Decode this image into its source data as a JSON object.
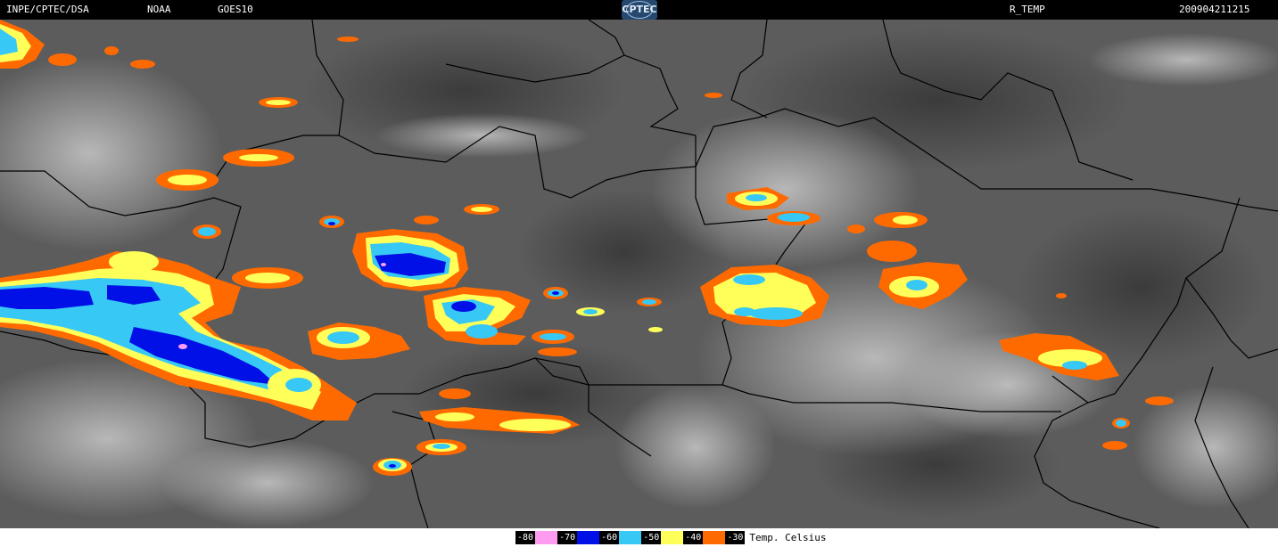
{
  "header": {
    "source": "INPE/CPTEC/DSA",
    "agency": "NOAA",
    "satellite": "GOES10",
    "logo_text": "CPTEC",
    "product": "R_TEMP",
    "timestamp": "200904211215"
  },
  "legend": {
    "unit_label": "Temp. Celsius",
    "entries": [
      {
        "label": "-80",
        "color": "#ff9cf0"
      },
      {
        "label": "-70",
        "color": "#0010e6"
      },
      {
        "label": "-60",
        "color": "#37c8f5"
      },
      {
        "label": "-50",
        "color": "#ffff5a"
      },
      {
        "label": "-40",
        "color": "#ff6a00"
      },
      {
        "label": "-30",
        "color": "#000000"
      }
    ]
  },
  "colors": {
    "background": "#5a5a5a",
    "borders": "#000000",
    "header_bg": "#000000"
  }
}
